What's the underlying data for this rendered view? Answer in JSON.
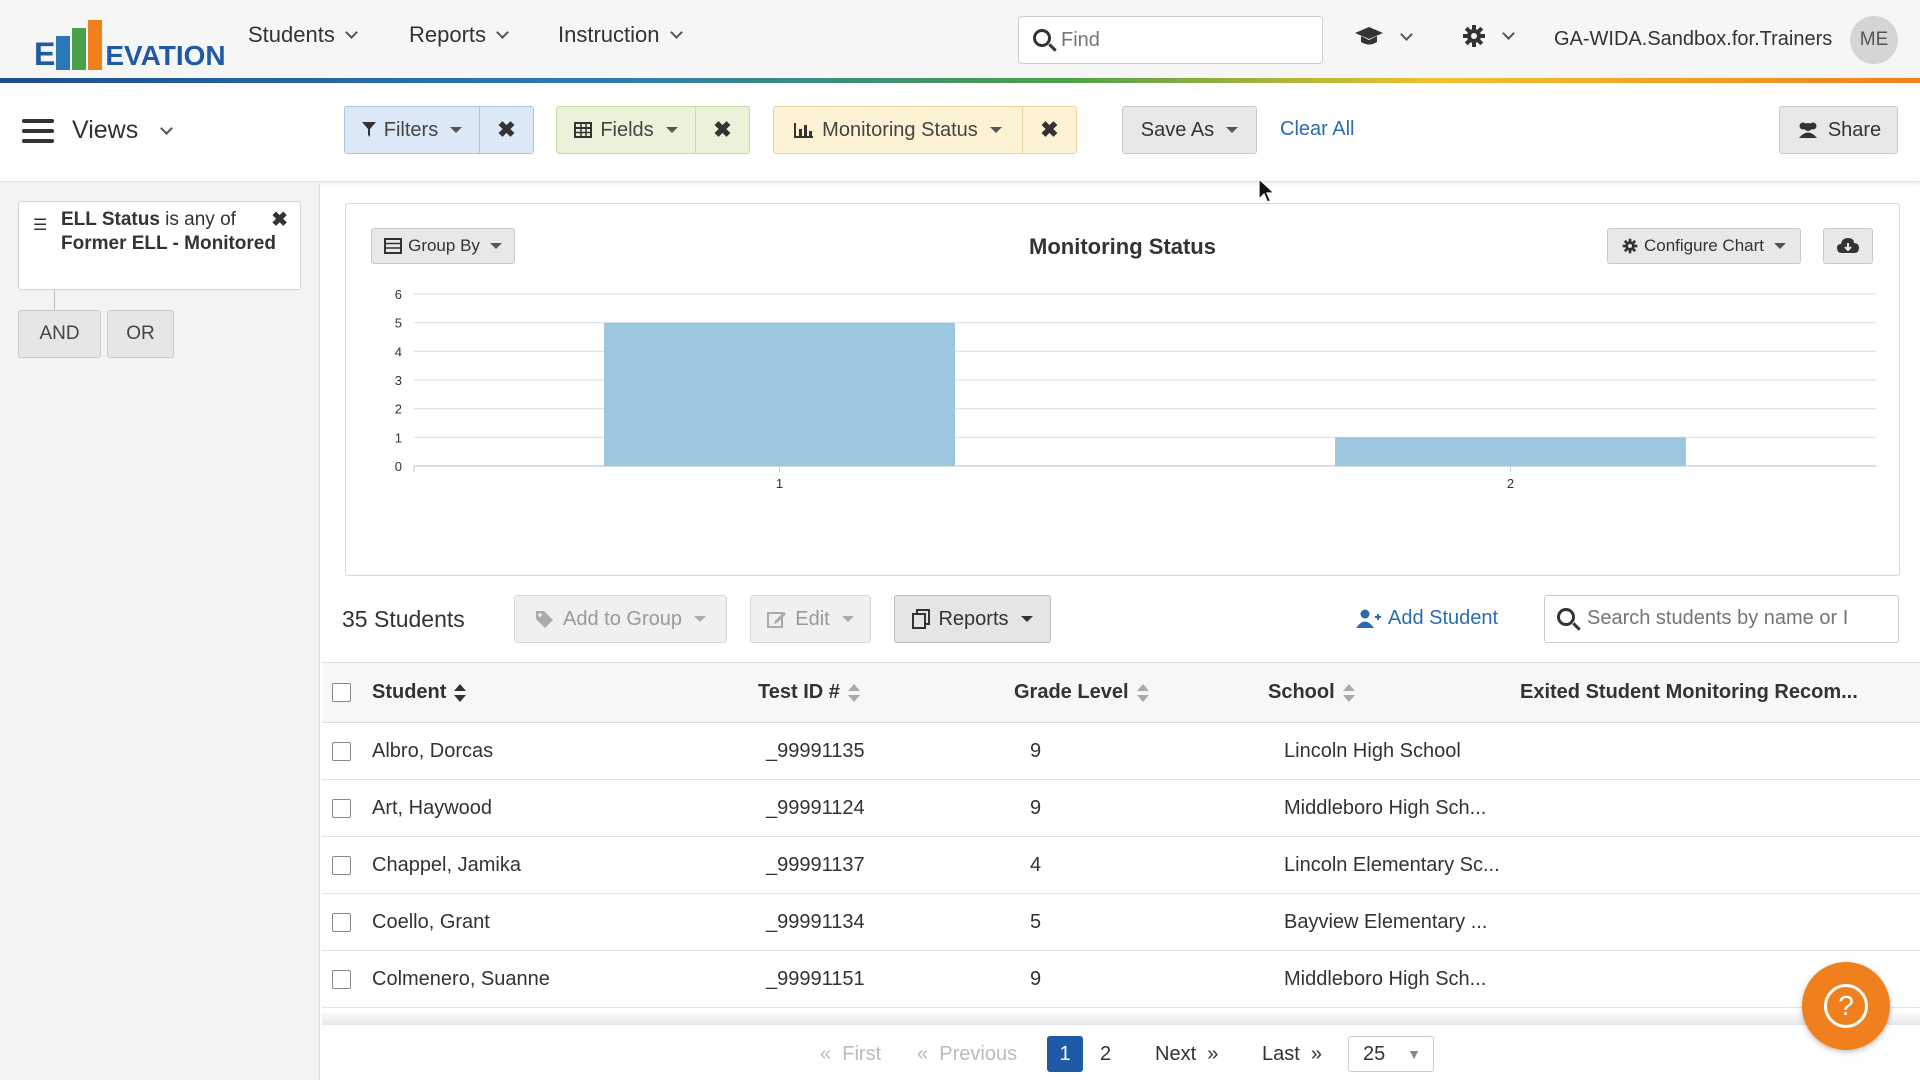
{
  "app": {
    "logo_text": "ELLEVATION",
    "colors": {
      "brand_blue": "#1f5aa6",
      "accent_orange": "#f07f1e",
      "link": "#2b6cb0",
      "bar_fill": "#9dc6df"
    }
  },
  "topnav": {
    "menus": [
      {
        "label": "Students"
      },
      {
        "label": "Reports"
      },
      {
        "label": "Instruction"
      }
    ],
    "search_placeholder": "Find",
    "account_name": "GA-WIDA.Sandbox.for.Trainers",
    "avatar_initials": "ME",
    "icons": [
      "graduation-cap-icon",
      "gear-icon"
    ]
  },
  "toolbar": {
    "views_label": "Views",
    "filters_label": "Filters",
    "fields_label": "Fields",
    "chart_label": "Monitoring Status",
    "save_as_label": "Save As",
    "clear_all_label": "Clear All",
    "share_label": "Share"
  },
  "sidebar": {
    "filter": {
      "field": "ELL Status",
      "operator": "is any of",
      "value": "Former ELL - Monitored"
    },
    "and_label": "AND",
    "or_label": "OR"
  },
  "chart_panel": {
    "group_by_label": "Group By",
    "configure_label": "Configure Chart",
    "icons": [
      "cloud-download-icon"
    ]
  },
  "chart_data": {
    "type": "bar",
    "title": "Monitoring Status",
    "categories": [
      "1",
      "2"
    ],
    "values": [
      5,
      1
    ],
    "ylim": [
      0,
      6
    ],
    "yticks": [
      "0",
      "1",
      "2",
      "3",
      "4",
      "5",
      "6"
    ],
    "grid": true,
    "xlabel": "",
    "ylabel": ""
  },
  "list": {
    "count_label": "35 Students",
    "add_to_group_label": "Add to Group",
    "edit_label": "Edit",
    "reports_label": "Reports",
    "add_student_label": "Add Student",
    "search_placeholder": "Search students by name or I",
    "columns": [
      "Student",
      "Test ID #",
      "Grade Level",
      "School",
      "Exited Student Monitoring Recom..."
    ],
    "rows": [
      {
        "student": "Albro, Dorcas",
        "test_id": "_99991135",
        "grade": "9",
        "school": "Lincoln High School"
      },
      {
        "student": "Art, Haywood",
        "test_id": "_99991124",
        "grade": "9",
        "school": "Middleboro High Sch..."
      },
      {
        "student": "Chappel, Jamika",
        "test_id": "_99991137",
        "grade": "4",
        "school": "Lincoln Elementary Sc..."
      },
      {
        "student": "Coello, Grant",
        "test_id": "_99991134",
        "grade": "5",
        "school": "Bayview Elementary ..."
      },
      {
        "student": "Colmenero, Suanne",
        "test_id": "_99991151",
        "grade": "9",
        "school": "Middleboro High Sch..."
      }
    ]
  },
  "pagination": {
    "first_label": "First",
    "previous_label": "Previous",
    "pages": [
      "1",
      "2"
    ],
    "current_page": "1",
    "next_label": "Next",
    "last_label": "Last",
    "page_size": "25"
  }
}
